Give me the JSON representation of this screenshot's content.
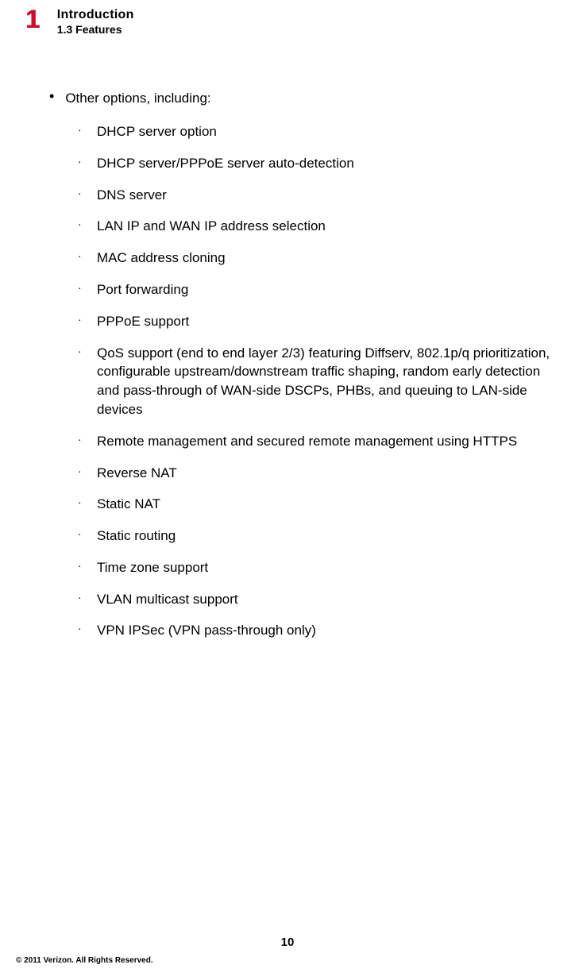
{
  "header": {
    "chapter_number": "1",
    "chapter_title": "Introduction",
    "section_label": "1.3  Features"
  },
  "main": {
    "bullet_label": "Other options, including:",
    "sub_items": [
      "DHCP server option",
      "DHCP server/PPPoE server auto-detection",
      "DNS server",
      "LAN IP and WAN IP address selection",
      "MAC address cloning",
      "Port forwarding",
      "PPPoE support",
      "QoS support (end to end layer 2/3) featuring Diffserv, 802.1p/q prioritization, configurable upstream/downstream traffic shaping, random early detection and pass-through of WAN-side DSCPs, PHBs, and queuing to LAN-side devices",
      "Remote management and secured remote management using HTTPS",
      "Reverse NAT",
      "Static NAT",
      "Static routing",
      "Time zone support",
      "VLAN multicast support",
      "VPN IPSec (VPN pass-through only)"
    ]
  },
  "footer": {
    "page_number": "10",
    "copyright": "© 2011 Verizon. All Rights Reserved."
  }
}
